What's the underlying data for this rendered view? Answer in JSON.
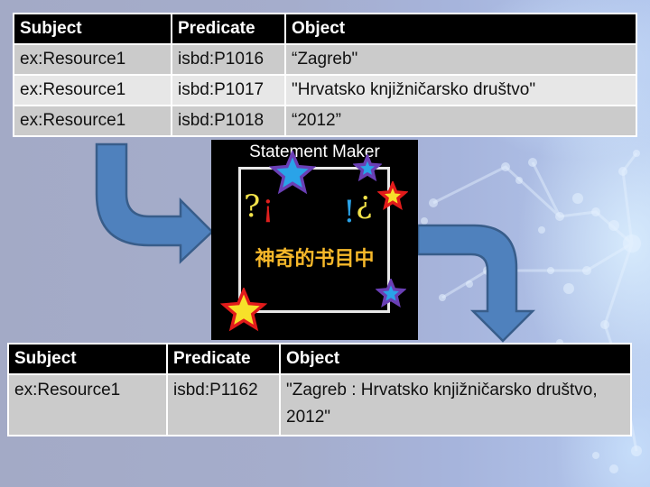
{
  "slide": {
    "background_accent": "#a5adcc"
  },
  "top_table": {
    "headers": [
      "Subject",
      "Predicate",
      "Object"
    ],
    "rows": [
      [
        "ex:Resource1",
        "isbd:P1016",
        "“Zagreb\""
      ],
      [
        "ex:Resource1",
        "isbd:P1017",
        "\"Hrvatsko knjižničarsko društvo\""
      ],
      [
        "ex:Resource1",
        "isbd:P1018",
        "“2012”"
      ]
    ]
  },
  "statement_maker": {
    "title": "Statement Maker",
    "glyphs": [
      "?",
      "¡",
      "!",
      "¿"
    ],
    "chinese_text": "神奇的书目中",
    "stars": [
      {
        "name": "blue-star-large",
        "fill": "#2aa3e8",
        "stroke": "#6a3fb5"
      },
      {
        "name": "blue-star-small",
        "fill": "#2aa3e8",
        "stroke": "#6a3fb5"
      },
      {
        "name": "red-star-small",
        "fill": "#f7e02a",
        "stroke": "#e21b1b"
      },
      {
        "name": "red-star-large",
        "fill": "#f7e02a",
        "stroke": "#e21b1b"
      },
      {
        "name": "blue-star-bottom",
        "fill": "#2aa3e8",
        "stroke": "#6a3fb5"
      }
    ]
  },
  "arrows": {
    "fill": "#4f81bd",
    "stroke": "#385d8a"
  },
  "bottom_table": {
    "headers": [
      "Subject",
      "Predicate",
      "Object"
    ],
    "rows": [
      [
        "ex:Resource1",
        "isbd:P1162",
        "\"Zagreb : Hrvatsko knjižničarsko društvo, 2012\""
      ]
    ]
  }
}
